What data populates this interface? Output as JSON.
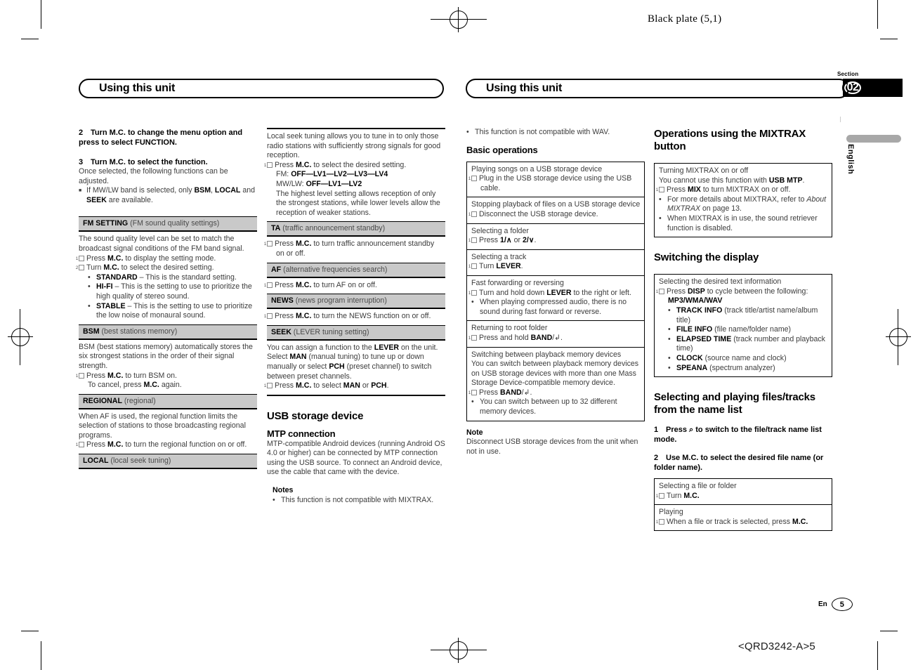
{
  "header": {
    "black_plate": "Black plate (5,1)"
  },
  "section": {
    "label": "Section",
    "number": "02",
    "language": "English"
  },
  "running_head": {
    "left": "Using this unit",
    "right": "Using this unit"
  },
  "footer": {
    "code": "<QRD3242-A>5",
    "lang": "En",
    "page": "5"
  },
  "col1": {
    "step2": {
      "num": "2",
      "text": "Turn M.C. to change the menu option and press to select FUNCTION."
    },
    "step3": {
      "num": "3",
      "text": "Turn M.C. to select the function."
    },
    "step3_body": "Once selected, the following functions can be adjusted.",
    "step3_bullet_a": "If MW/LW band is selected, only ",
    "step3_bullet_b": "BSM",
    "step3_bullet_c": ", ",
    "step3_bullet_d": "LOCAL",
    "step3_bullet_e": " and ",
    "step3_bullet_f": "SEEK",
    "step3_bullet_g": " are available.",
    "fm_setting": {
      "title": "FM SETTING",
      "subtitle": " (FM sound quality settings)",
      "body": "The sound quality level can be set to match the broadcast signal conditions of the FM band signal.",
      "step1_a": "Press ",
      "step1_b": "M.C.",
      "step1_c": " to display the setting mode.",
      "step2_a": "Turn ",
      "step2_b": "M.C.",
      "step2_c": " to select the desired setting.",
      "opt1_b": "STANDARD",
      "opt1_t": " – This is the standard setting.",
      "opt2_b": "HI-FI",
      "opt2_t": " – This is the setting to use to prioritize the high quality of stereo sound.",
      "opt3_b": "STABLE",
      "opt3_t": " – This is the setting to use to prioritize the low noise of monaural sound."
    },
    "bsm": {
      "title": "BSM",
      "subtitle": " (best stations memory)",
      "body": "BSM (best stations memory) automatically stores the six strongest stations in the order of their signal strength.",
      "step1_a": "Press ",
      "step1_b": "M.C.",
      "step1_c": " to turn BSM on.",
      "step1_d": "To cancel, press ",
      "step1_e": "M.C.",
      "step1_f": " again."
    },
    "regional": {
      "title": "REGIONAL",
      "subtitle": " (regional)",
      "body": "When AF is used, the regional function limits the selection of stations to those broadcasting regional programs.",
      "step1_a": "Press ",
      "step1_b": "M.C.",
      "step1_c": " to turn the regional function on or off."
    },
    "local": {
      "title": "LOCAL",
      "subtitle": " (local seek tuning)"
    }
  },
  "col2": {
    "local_body": "Local seek tuning allows you to tune in to only those radio stations with sufficiently strong signals for good reception.",
    "local_step_a": "Press ",
    "local_step_b": "M.C.",
    "local_step_c": " to select the desired setting.",
    "local_fm_label": "FM: ",
    "local_fm_values": "OFF—LV1—LV2—LV3—LV4",
    "local_mw_label": "MW/LW: ",
    "local_mw_values": "OFF—LV1—LV2",
    "local_note": "The highest level setting allows reception of only the strongest stations, while lower levels allow the reception of weaker stations.",
    "ta": {
      "title": "TA",
      "subtitle": " (traffic announcement standby)",
      "step_a": "Press ",
      "step_b": "M.C.",
      "step_c": " to turn traffic announcement standby on or off."
    },
    "af": {
      "title": "AF",
      "subtitle": " (alternative frequencies search)",
      "step_a": "Press ",
      "step_b": "M.C.",
      "step_c": " to turn AF on or off."
    },
    "news": {
      "title": "NEWS",
      "subtitle": " (news program interruption)",
      "step_a": "Press ",
      "step_b": "M.C.",
      "step_c": " to turn the NEWS function on or off."
    },
    "seek": {
      "title": "SEEK",
      "subtitle": " (LEVER tuning setting)",
      "body_a": "You can assign a function to the ",
      "body_b": "LEVER",
      "body_c": " on the unit.",
      "body2_a": "Select ",
      "body2_b": "MAN",
      "body2_c": " (manual tuning) to tune up or down manually or select ",
      "body2_d": "PCH",
      "body2_e": " (preset channel) to switch between preset channels.",
      "step_a": "Press ",
      "step_b": "M.C.",
      "step_c": " to select ",
      "step_d": "MAN",
      "step_e": " or ",
      "step_f": "PCH",
      "step_g": "."
    },
    "usb_heading": "USB storage device",
    "mtp_heading": "MTP connection",
    "mtp_body": "MTP-compatible Android devices (running Android OS 4.0 or higher) can be connected by MTP connection using the USB source. To connect an Android device, use the cable that came with the device.",
    "notes_label": "Notes",
    "note_bullet": "This function is not compatible with MIXTRAX."
  },
  "col3": {
    "top_bullet": "This function is not compatible with WAV.",
    "basic_heading": "Basic operations",
    "rows": [
      {
        "title": "Playing songs on a USB storage device",
        "step": "Plug in the USB storage device using the USB cable."
      },
      {
        "title": "Stopping playback of files on a USB storage device",
        "step": "Disconnect the USB storage device."
      },
      {
        "title": "Selecting a folder",
        "step_a": "Press ",
        "step_b": "1/∧",
        "step_c": " or ",
        "step_d": "2/∨",
        "step_e": "."
      },
      {
        "title": "Selecting a track",
        "step_a": "Turn ",
        "step_b": "LEVER",
        "step_c": "."
      },
      {
        "title": "Fast forwarding or reversing",
        "step_a": "Turn and hold down ",
        "step_b": "LEVER",
        "step_c": " to the right or left.",
        "bullet": "When playing compressed audio, there is no sound during fast forward or reverse."
      },
      {
        "title": "Returning to root folder",
        "step_a": "Press and hold ",
        "step_b": "BAND",
        "step_c": "/↲."
      },
      {
        "title": "Switching between playback memory devices",
        "body": "You can switch between playback memory devices on USB storage devices with more than one Mass Storage Device-compatible memory device.",
        "step_a": "Press ",
        "step_b": "BAND",
        "step_c": "/↲.",
        "bullet": "You can switch between up to 32 different memory devices."
      }
    ],
    "note_label": "Note",
    "note_body": "Disconnect USB storage devices from the unit when not in use."
  },
  "col4": {
    "mixtrax_heading": "Operations using the MIXTRAX button",
    "mixtrax_box": {
      "title": "Turning MIXTRAX on or off",
      "line2_a": "You cannot use this function with ",
      "line2_b": "USB MTP",
      "line2_c": ".",
      "step_a": "Press ",
      "step_b": "MIX",
      "step_c": " to turn MIXTRAX on or off.",
      "bullet1_a": "For more details about MIXTRAX, refer to ",
      "bullet1_i": "About MIXTRAX",
      "bullet1_b": " on page 13.",
      "bullet2": "When MIXTRAX is in use, the sound retriever function is disabled."
    },
    "switching_heading": "Switching the display",
    "switching_box": {
      "title": "Selecting the desired text information",
      "step_a": "Press ",
      "step_b": "DISP",
      "step_c": " to cycle between the following:",
      "format": "MP3/WMA/WAV",
      "items": [
        {
          "b": "TRACK INFO",
          "t": " (track title/artist name/album title)"
        },
        {
          "b": "FILE INFO",
          "t": " (file name/folder name)"
        },
        {
          "b": "ELAPSED TIME",
          "t": " (track number and playback time)"
        },
        {
          "b": "CLOCK",
          "t": " (source name and clock)"
        },
        {
          "b": "SPEANA",
          "t": " (spectrum analyzer)"
        }
      ]
    },
    "name_list_heading": "Selecting and playing files/tracks from the name list",
    "step1_num": "1",
    "step1_a": "Press ",
    "step1_icon": "⌕",
    "step1_b": " to switch to the file/track name list mode.",
    "step2_num": "2",
    "step2": "Use M.C. to select the desired file name (or folder name).",
    "name_rows": [
      {
        "title": "Selecting a file or folder",
        "step_a": "Turn ",
        "step_b": "M.C.",
        "step_c": ""
      },
      {
        "title": "Playing",
        "step_a": "When a file or track is selected, press ",
        "step_b": "M.C.",
        "step_c": ""
      }
    ]
  }
}
